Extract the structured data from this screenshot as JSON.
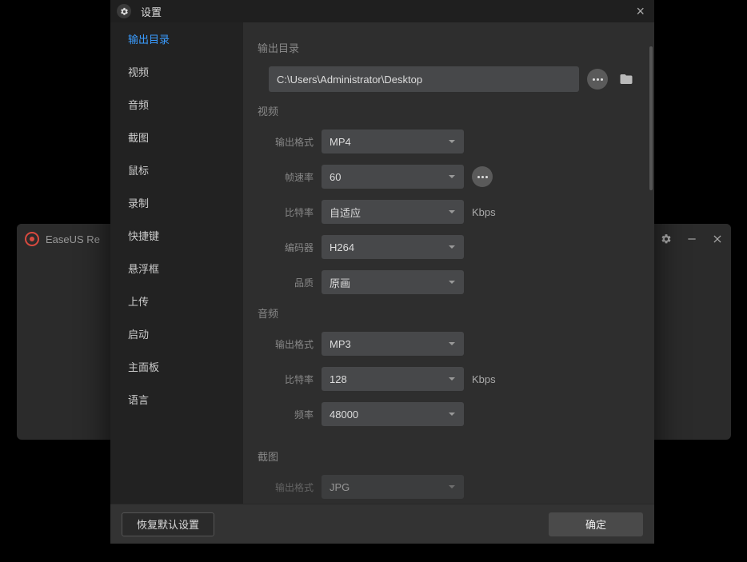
{
  "bg_app": {
    "title": "EaseUS Re"
  },
  "modal": {
    "title": "设置",
    "close": "×"
  },
  "sidebar": {
    "items": [
      {
        "label": "输出目录",
        "active": true
      },
      {
        "label": "视频"
      },
      {
        "label": "音频"
      },
      {
        "label": "截图"
      },
      {
        "label": "鼠标"
      },
      {
        "label": "录制"
      },
      {
        "label": "快捷键"
      },
      {
        "label": "悬浮框"
      },
      {
        "label": "上传"
      },
      {
        "label": "启动"
      },
      {
        "label": "主面板"
      },
      {
        "label": "语言"
      }
    ]
  },
  "sections": {
    "output_dir": {
      "title": "输出目录",
      "path": "C:\\Users\\Administrator\\Desktop"
    },
    "video": {
      "title": "视频",
      "rows": {
        "format": {
          "label": "输出格式",
          "value": "MP4"
        },
        "fps": {
          "label": "帧速率",
          "value": "60"
        },
        "bitrate": {
          "label": "比特率",
          "value": "自适应",
          "unit": "Kbps"
        },
        "encoder": {
          "label": "编码器",
          "value": "H264"
        },
        "quality": {
          "label": "品质",
          "value": "原画"
        }
      }
    },
    "audio": {
      "title": "音频",
      "rows": {
        "format": {
          "label": "输出格式",
          "value": "MP3"
        },
        "bitrate": {
          "label": "比特率",
          "value": "128",
          "unit": "Kbps"
        },
        "freq": {
          "label": "频率",
          "value": "48000"
        }
      }
    },
    "screenshot": {
      "title": "截图",
      "rows": {
        "format": {
          "label": "输出格式",
          "value": "JPG"
        }
      }
    }
  },
  "footer": {
    "reset": "恢复默认设置",
    "ok": "确定"
  }
}
